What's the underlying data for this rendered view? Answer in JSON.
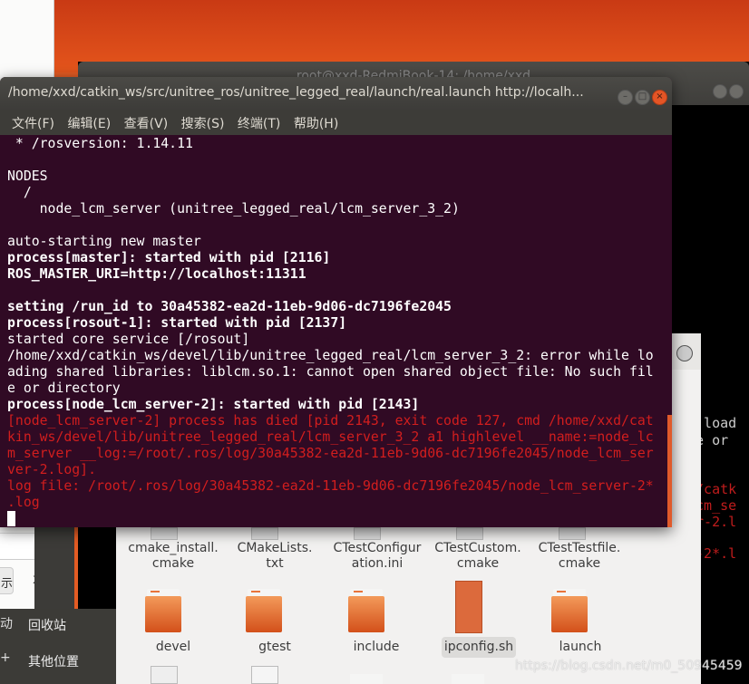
{
  "back_terminal": {
    "title": "root@xxd-RedmiBook-14: /home/xxd",
    "visible_fragments": [
      "e load",
      "le or",
      "d/catk",
      "lcm_se",
      "er-2.l",
      "r-2*.l"
    ]
  },
  "left_dialog": {
    "button_label": "示",
    "close_label": "x"
  },
  "file_manager": {
    "sidebar": [
      {
        "label": "回收站",
        "partial_icon": "动"
      },
      {
        "label": "其他位置",
        "partial_icon": "+"
      }
    ],
    "files_row1": [
      "cmake_install.\ncmake",
      "CMakeLists.\ntxt",
      "CTestConfigur\nation.ini",
      "CTestCustom.\ncmake",
      "CTestTestfile.\ncmake"
    ],
    "files_row2": [
      {
        "name": "devel",
        "type": "folder"
      },
      {
        "name": "gtest",
        "type": "folder"
      },
      {
        "name": "include",
        "type": "folder"
      },
      {
        "name": "ipconfig.sh",
        "type": "script",
        "selected": true
      },
      {
        "name": "launch",
        "type": "folder"
      }
    ]
  },
  "terminal": {
    "title": "/home/xxd/catkin_ws/src/unitree_ros/unitree_legged_real/launch/real.launch http://localh...",
    "menu": [
      "文件(F)",
      "编辑(E)",
      "查看(V)",
      "搜索(S)",
      "终端(T)",
      "帮助(H)"
    ],
    "lines": [
      {
        "text": " * /rosversion: 1.14.11",
        "style": "normal"
      },
      {
        "text": "",
        "style": "normal"
      },
      {
        "text": "NODES",
        "style": "normal"
      },
      {
        "text": "  /",
        "style": "normal"
      },
      {
        "text": "    node_lcm_server (unitree_legged_real/lcm_server_3_2)",
        "style": "normal"
      },
      {
        "text": "",
        "style": "normal"
      },
      {
        "text": "auto-starting new master",
        "style": "normal"
      },
      {
        "text": "process[master]: started with pid [2116]",
        "style": "bold"
      },
      {
        "text": "ROS_MASTER_URI=http://localhost:11311",
        "style": "bold"
      },
      {
        "text": "",
        "style": "normal"
      },
      {
        "text": "setting /run_id to 30a45382-ea2d-11eb-9d06-dc7196fe2045",
        "style": "bold"
      },
      {
        "text": "process[rosout-1]: started with pid [2137]",
        "style": "bold"
      },
      {
        "text": "started core service [/rosout]",
        "style": "normal"
      },
      {
        "text": "/home/xxd/catkin_ws/devel/lib/unitree_legged_real/lcm_server_3_2: error while lo",
        "style": "normal"
      },
      {
        "text": "ading shared libraries: liblcm.so.1: cannot open shared object file: No such fil",
        "style": "normal"
      },
      {
        "text": "e or directory",
        "style": "normal"
      },
      {
        "text": "process[node_lcm_server-2]: started with pid [2143]",
        "style": "bold"
      },
      {
        "text": "[node_lcm_server-2] process has died [pid 2143, exit code 127, cmd /home/xxd/cat",
        "style": "error"
      },
      {
        "text": "kin_ws/devel/lib/unitree_legged_real/lcm_server_3_2 a1 highlevel __name:=node_lc",
        "style": "error"
      },
      {
        "text": "m_server __log:=/root/.ros/log/30a45382-ea2d-11eb-9d06-dc7196fe2045/node_lcm_ser",
        "style": "error"
      },
      {
        "text": "ver-2.log].",
        "style": "error"
      },
      {
        "text": "log file: /root/.ros/log/30a45382-ea2d-11eb-9d06-dc7196fe2045/node_lcm_server-2*",
        "style": "error"
      },
      {
        "text": ".log",
        "style": "error"
      }
    ]
  },
  "watermark": "https://blog.csdn.net/m0_50945459",
  "colors": {
    "terminal_bg": "#300a24",
    "error": "#d21e1e",
    "ubuntu_orange": "#e45526"
  }
}
